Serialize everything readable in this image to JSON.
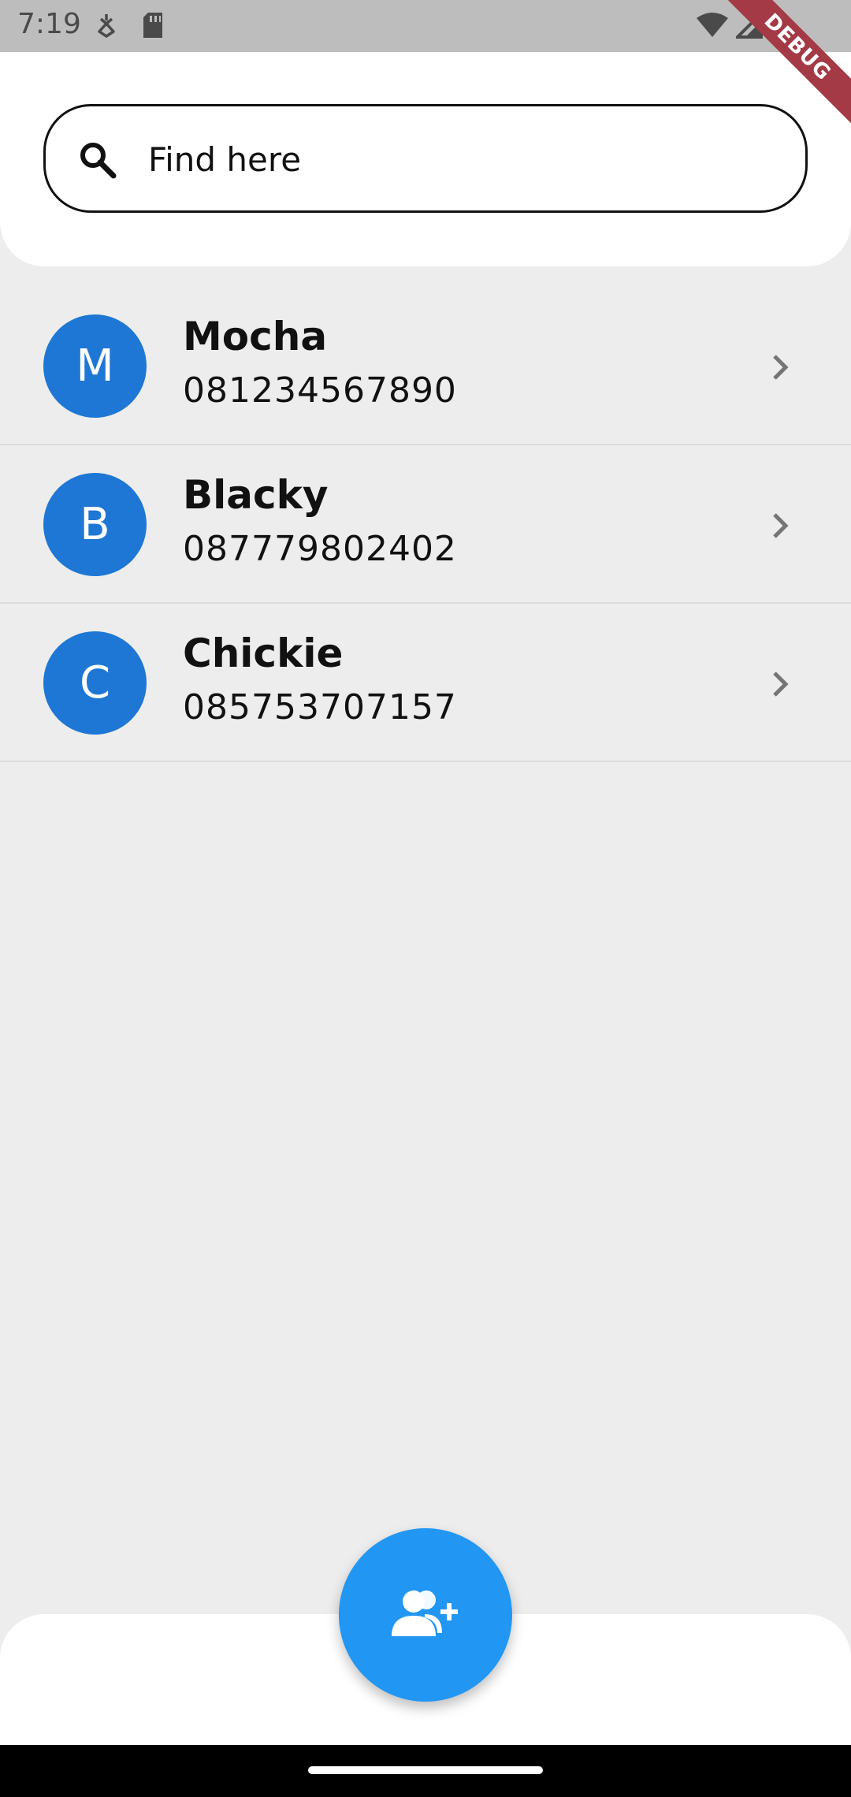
{
  "status_bar": {
    "time": "7:19",
    "left_icons": [
      "debug-bug-icon",
      "sd-card-icon"
    ],
    "right_icons": [
      "wifi-icon",
      "signal-icon",
      "battery-icon"
    ]
  },
  "debug_banner": "DEBUG",
  "search": {
    "placeholder": "Find here",
    "value": "",
    "icon": "search-icon"
  },
  "contacts": [
    {
      "initial": "M",
      "name": "Mocha",
      "phone": "081234567890"
    },
    {
      "initial": "B",
      "name": "Blacky",
      "phone": "087779802402"
    },
    {
      "initial": "C",
      "name": "Chickie",
      "phone": "085753707157"
    }
  ],
  "fab": {
    "icon": "add-user-icon"
  },
  "colors": {
    "avatar": "#1e77d4",
    "fab": "#2196f3",
    "background": "#ededed",
    "debug_ribbon": "#a33a45"
  }
}
